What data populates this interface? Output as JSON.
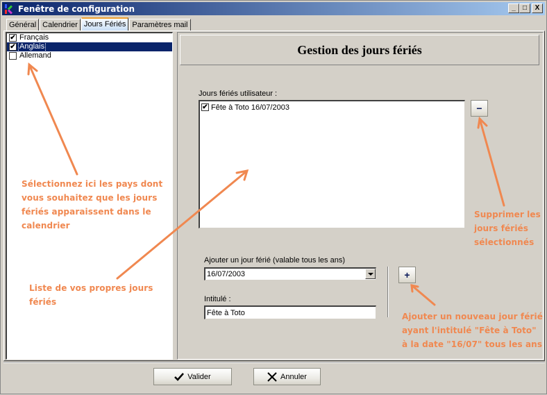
{
  "window": {
    "title": "Fenêtre de configuration",
    "controls": {
      "minimize": "_",
      "maximize": "□",
      "close": "X"
    }
  },
  "tabs": [
    {
      "label": "Général",
      "active": false
    },
    {
      "label": "Calendrier",
      "active": false
    },
    {
      "label": "Jours Fériés",
      "active": true
    },
    {
      "label": "Paramètres mail",
      "active": false
    }
  ],
  "countries": [
    {
      "label": "Français",
      "checked": true,
      "selected": false
    },
    {
      "label": "Anglais",
      "checked": true,
      "selected": true
    },
    {
      "label": "Allemand",
      "checked": false,
      "selected": false
    }
  ],
  "panel": {
    "title": "Gestion des jours fériés",
    "user_holidays_label": "Jours fériés utilisateur :",
    "user_holidays": [
      {
        "label": "Fête à Toto 16/07/2003",
        "checked": true
      }
    ],
    "remove_button": "−",
    "add_label": "Ajouter un jour férié (valable tous les ans)",
    "date_value": "16/07/2003",
    "intitule_label": "Intitulé :",
    "intitule_value": "Fête à Toto",
    "add_button": "+"
  },
  "annotations": {
    "countries": "Sélectionnez ici les pays dont vous souhaitez que les jours fériés apparaissent dans le calendrier",
    "own_list": "Liste de vos propres jours fériés",
    "delete": "Supprimer les jours fériés sélectionnés",
    "add": "Ajouter un nouveau jour férié ayant l'intitulé \"Fête à Toto\" à la date \"16/07\" tous les ans",
    "color": "#f08850"
  },
  "footer": {
    "ok_label": "Valider",
    "cancel_label": "Annuler"
  }
}
